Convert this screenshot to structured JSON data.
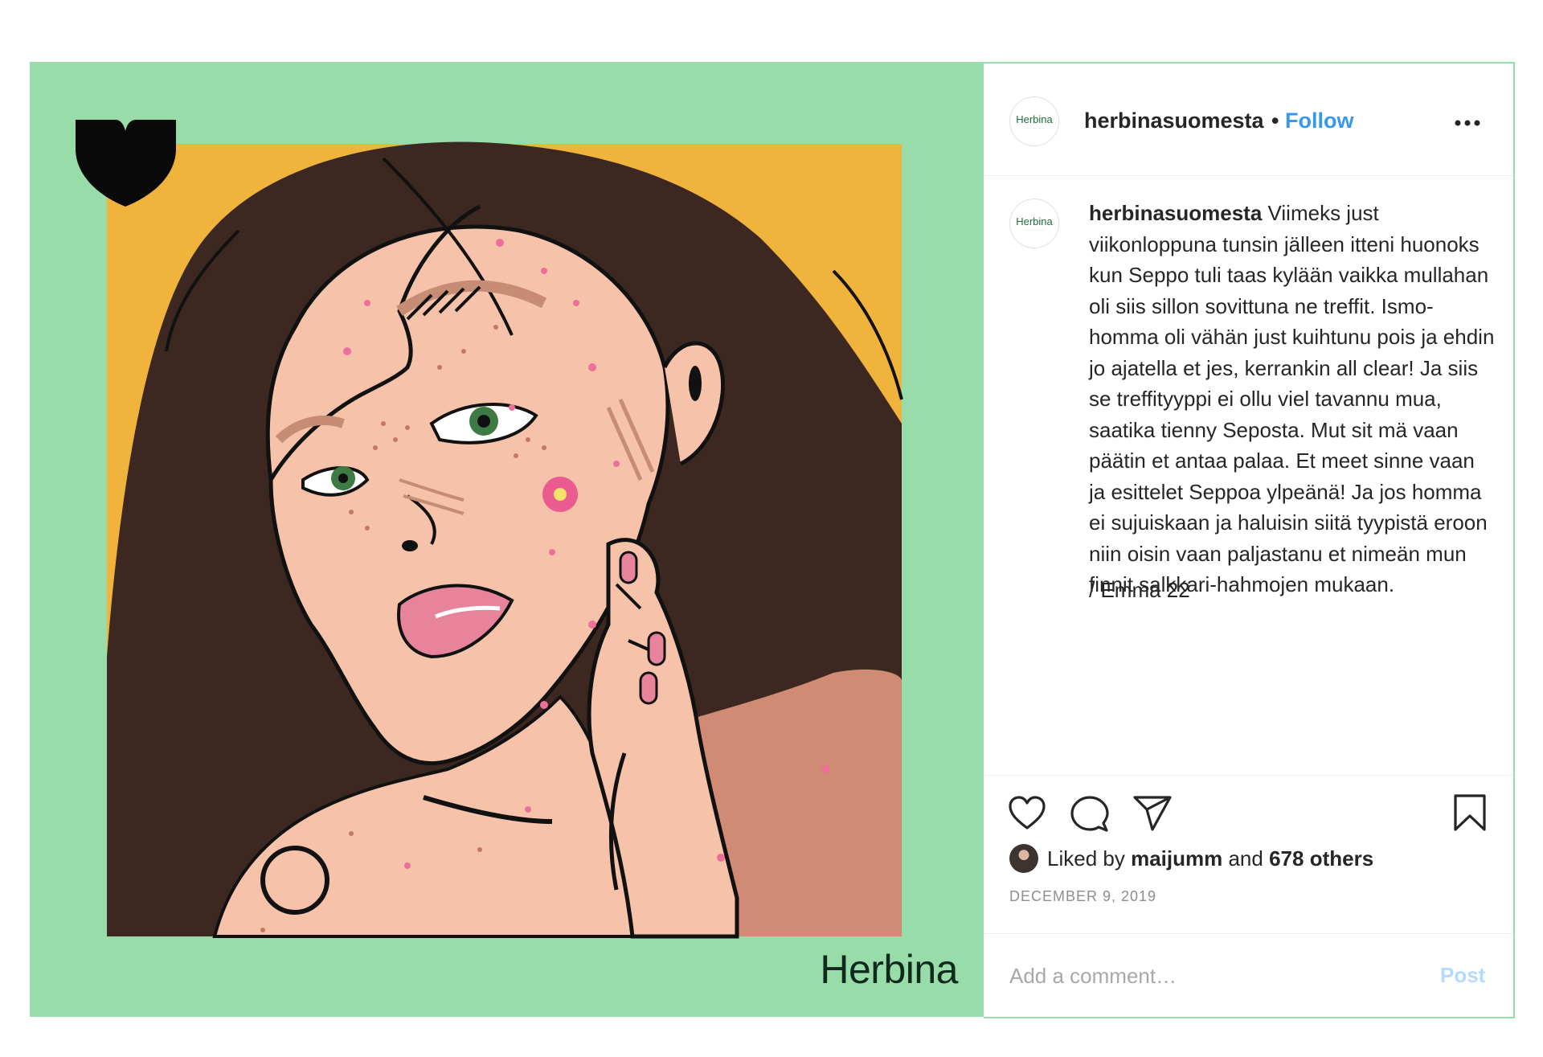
{
  "colors": {
    "frame_green": "#98dcaa",
    "art_background": "#f0b43c",
    "hair": "#3c2820",
    "skin": "#f7c2aa",
    "link_blue": "#3897f0",
    "post_disabled": "#b3dbff"
  },
  "media": {
    "wordmark": "Herbina",
    "brand_icon": "heart-shield-icon"
  },
  "header": {
    "avatar_logo": "Herbina",
    "username": "herbinasuomesta",
    "separator": "•",
    "follow_label": "Follow",
    "more_icon": "more-horizontal-icon"
  },
  "caption": {
    "avatar_logo": "Herbina",
    "username": "herbinasuomesta",
    "text": "Viimeks just viikonloppuna tunsin jälleen itteni huonoks kun Seppo tuli taas kylään vaikka mullahan oli siis sillon sovittuna ne treffit. Ismo-homma oli vähän just kuihtunu pois ja ehdin jo ajatella et jes, kerrankin all clear! Ja siis se treffityyppi ei ollu viel tavannu mua, saatika tienny Seposta. Mut sit mä vaan päätin et antaa palaa. Et meet sinne vaan ja esittelet Seppoa ylpeänä! Ja jos homma ei sujuiskaan ja haluisin siitä tyypistä eroon niin oisin vaan paljastanu et nimeän mun finnit salkkari-hahmojen mukaan.",
    "signature": "/ Emma 22"
  },
  "actions": {
    "like_icon": "heart-icon",
    "comment_icon": "comment-icon",
    "share_icon": "send-icon",
    "save_icon": "bookmark-icon"
  },
  "likes": {
    "prefix": "Liked by",
    "user": "maijumm",
    "middle": "and",
    "others": "678 others"
  },
  "date": "DECEMBER 9, 2019",
  "comment": {
    "placeholder": "Add a comment…",
    "post_label": "Post"
  }
}
